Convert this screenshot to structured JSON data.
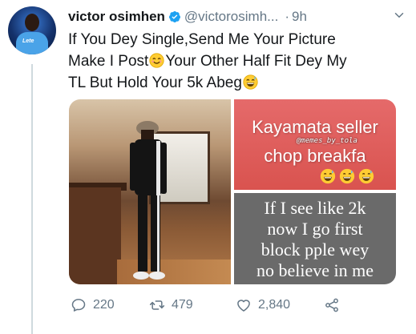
{
  "author": {
    "name": "victor osimhen",
    "handle": "@victorosimh...",
    "separator": "·",
    "time": "9h",
    "avatar_logo": "Lete"
  },
  "tweet": {
    "line1": "If You Dey Single,Send Me Your Picture",
    "line2a": "Make I Post",
    "line2b": "Your Other Half Fit Dey My",
    "line3": "TL But Hold Your 5k Abeg"
  },
  "media": {
    "meme1_line1": "Kayamata seller",
    "meme1_watermark": "@memes_by_tola",
    "meme1_line2": "chop breakfa",
    "meme2_lines": [
      "If I see like 2k",
      "now I go first",
      "block pple wey",
      "no believe in me"
    ]
  },
  "actions": {
    "replies": "220",
    "retweets": "479",
    "likes": "2,840"
  },
  "icons": {
    "verified": "verified-badge-icon",
    "caret": "chevron-down-icon",
    "reply": "reply-icon",
    "retweet": "retweet-icon",
    "like": "heart-icon",
    "share": "share-icon"
  },
  "colors": {
    "verified": "#1da1f2",
    "secondary_text": "#657786",
    "thread_line": "#cfd9de"
  }
}
